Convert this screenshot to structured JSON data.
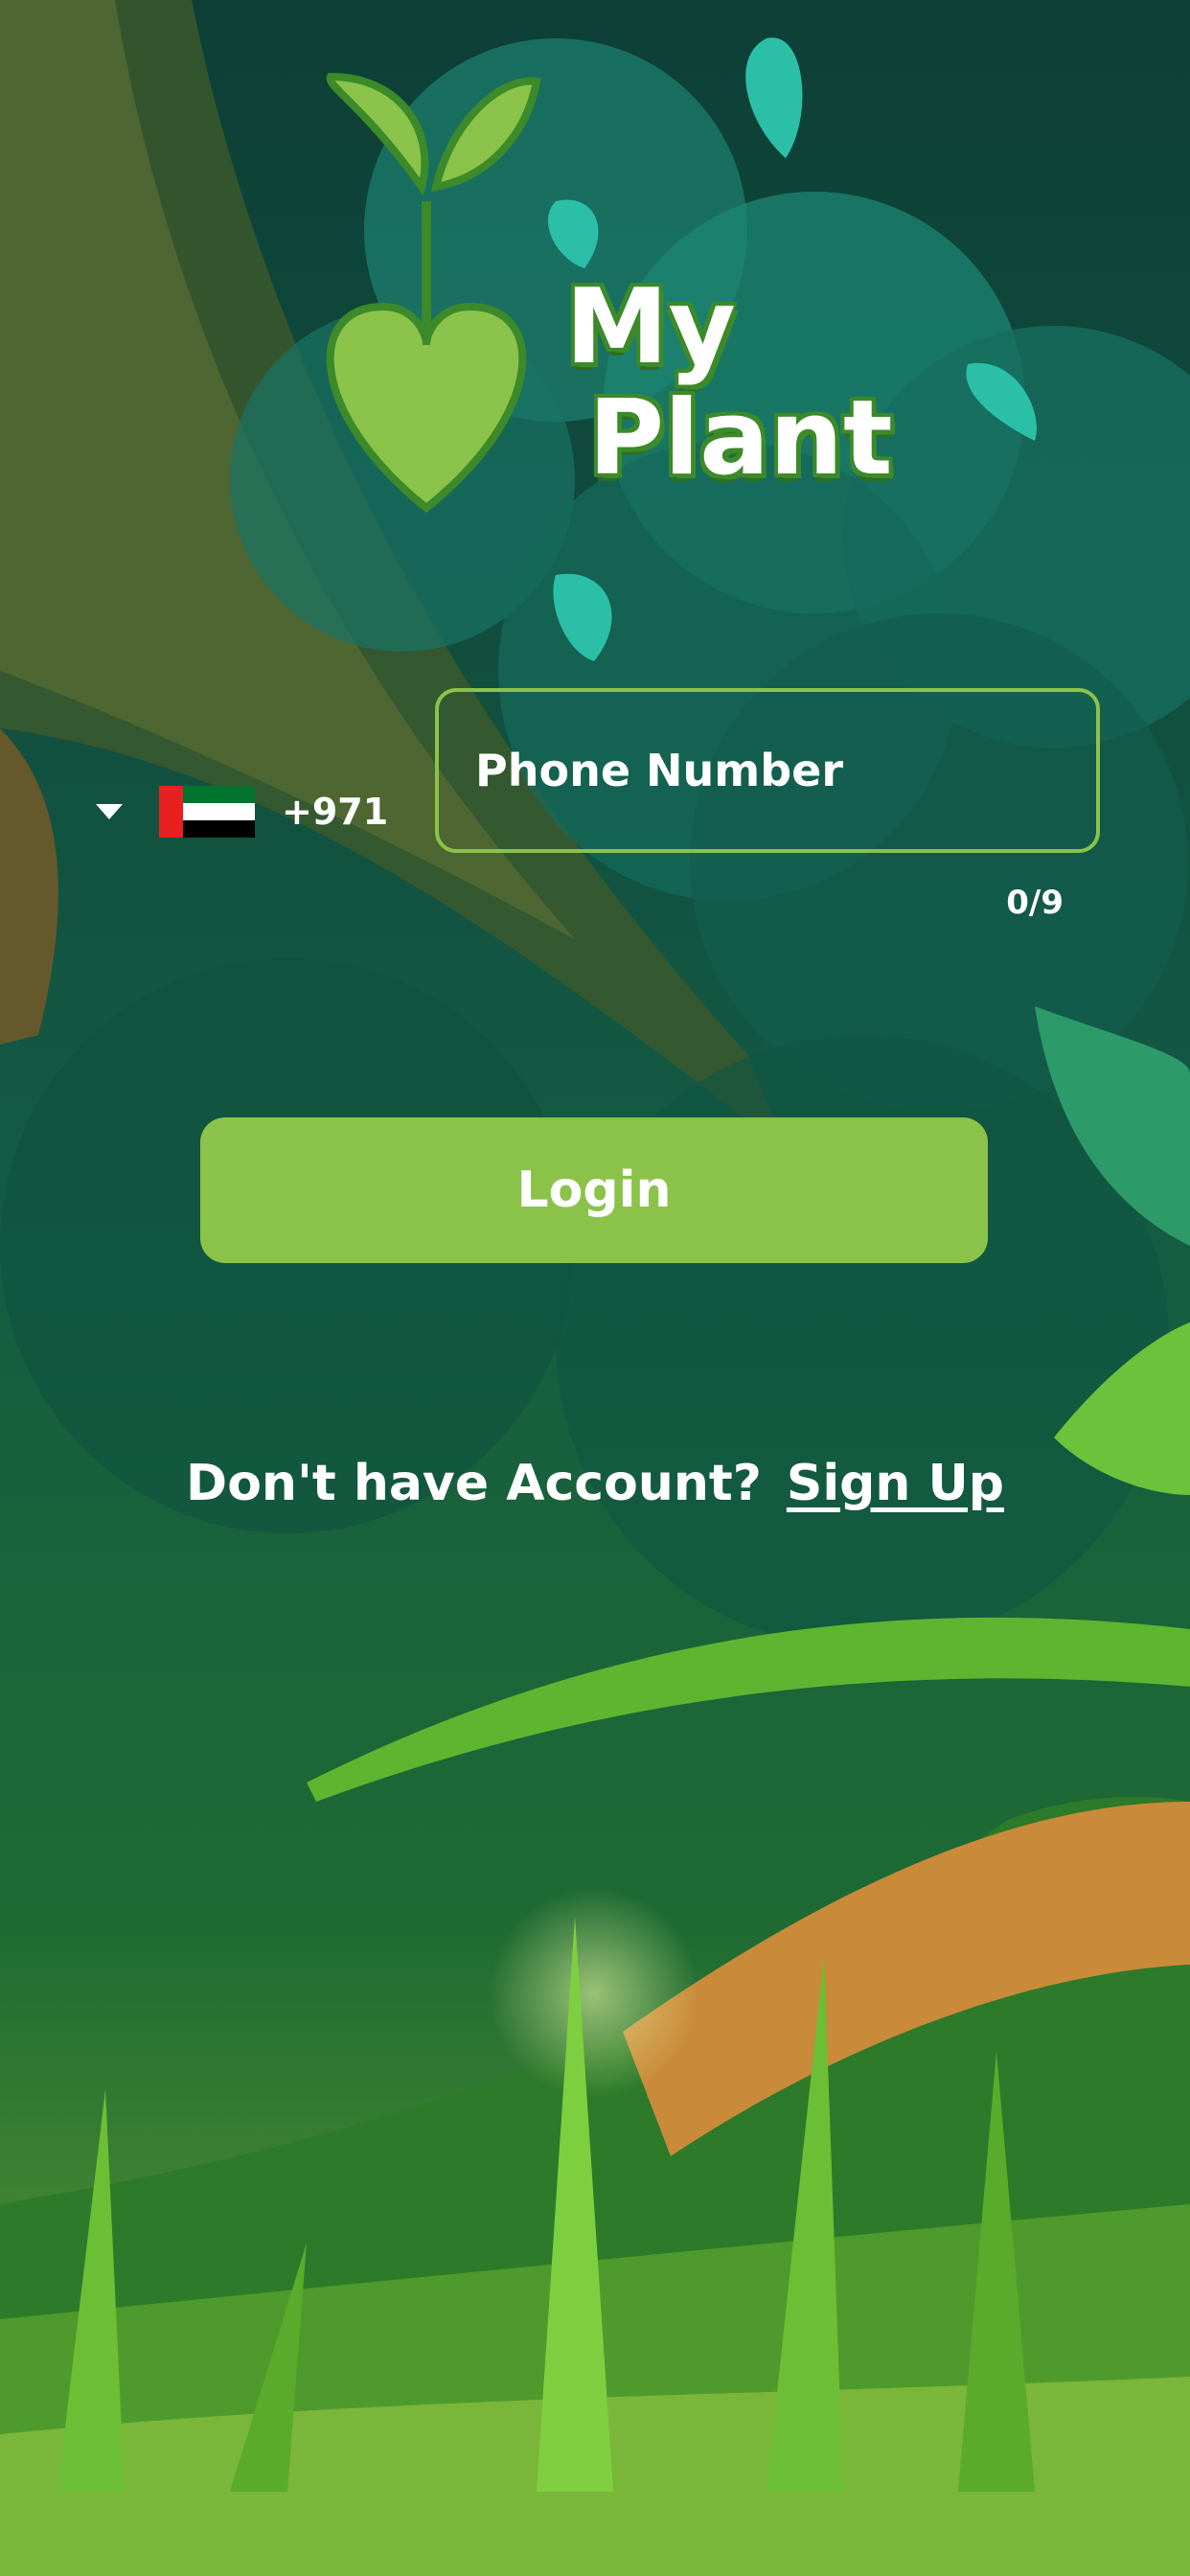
{
  "app": {
    "logo_line1": "My",
    "logo_line2": "Plant"
  },
  "login_form": {
    "country_code": "+971",
    "country_flag": "uae-flag-icon",
    "phone_placeholder": "Phone Number",
    "phone_value": "",
    "char_counter": "0/9",
    "login_label": "Login"
  },
  "footer": {
    "no_account_text": "Don't have Account?",
    "signup_label": "Sign Up"
  },
  "colors": {
    "accent": "#8bc34a",
    "background": "#0f4a3c",
    "text": "#ffffff"
  }
}
